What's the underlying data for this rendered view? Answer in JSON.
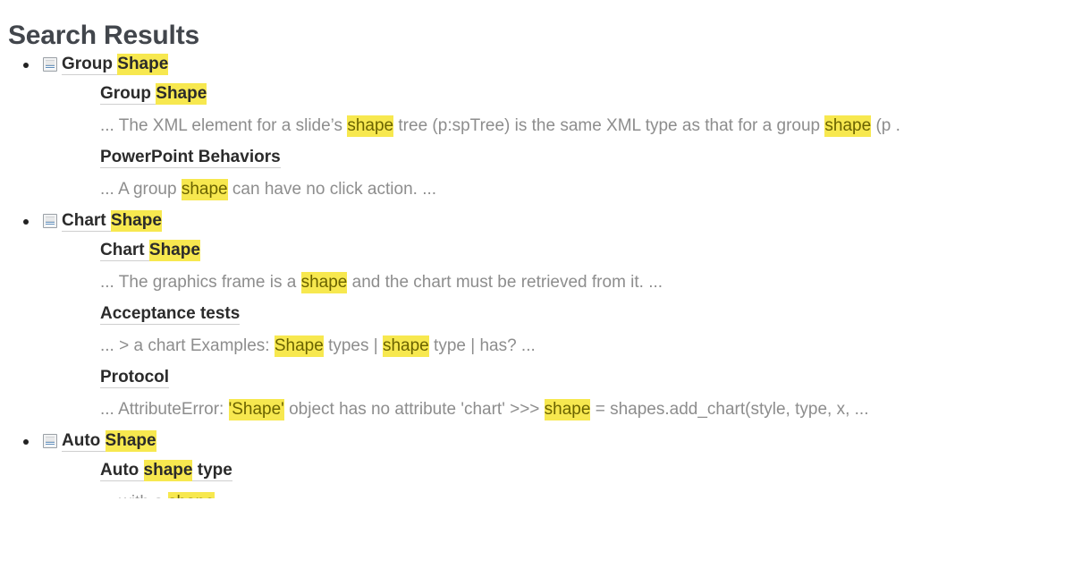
{
  "page": {
    "title": "Search Results",
    "highlight_color": "#f7e84f",
    "title_color": "#42464c",
    "snippet_color": "#8d8d8d",
    "link_color": "#2b2b2b"
  },
  "results": [
    {
      "icon": "document-icon",
      "link_parts": [
        {
          "text": "Group ",
          "highlight": false
        },
        {
          "text": "Shape",
          "highlight": true
        }
      ],
      "sub_results": [
        {
          "title_parts": [
            {
              "text": "Group ",
              "highlight": false
            },
            {
              "text": "Shape",
              "highlight": true
            }
          ],
          "snippet_parts": [
            {
              "text": "... The XML element for a slide’s ",
              "highlight": false
            },
            {
              "text": "shape",
              "highlight": true
            },
            {
              "text": " tree (p:spTree) is the same XML type as that for a group ",
              "highlight": false
            },
            {
              "text": "shape",
              "highlight": true
            },
            {
              "text": " (p .",
              "highlight": false
            }
          ]
        },
        {
          "title_parts": [
            {
              "text": "PowerPoint Behaviors",
              "highlight": false
            }
          ],
          "snippet_parts": [
            {
              "text": "... A group ",
              "highlight": false
            },
            {
              "text": "shape",
              "highlight": true
            },
            {
              "text": " can have no click action. ...",
              "highlight": false
            }
          ]
        }
      ]
    },
    {
      "icon": "document-icon",
      "link_parts": [
        {
          "text": "Chart ",
          "highlight": false
        },
        {
          "text": "Shape",
          "highlight": true
        }
      ],
      "sub_results": [
        {
          "title_parts": [
            {
              "text": "Chart ",
              "highlight": false
            },
            {
              "text": "Shape",
              "highlight": true
            }
          ],
          "snippet_parts": [
            {
              "text": "... The graphics frame is a ",
              "highlight": false
            },
            {
              "text": "shape",
              "highlight": true
            },
            {
              "text": " and the chart must be retrieved from it. ...",
              "highlight": false
            }
          ]
        },
        {
          "title_parts": [
            {
              "text": "Acceptance tests",
              "highlight": false
            }
          ],
          "snippet_parts": [
            {
              "text": "... > a chart Examples: ",
              "highlight": false
            },
            {
              "text": "Shape",
              "highlight": true
            },
            {
              "text": " types | ",
              "highlight": false
            },
            {
              "text": "shape",
              "highlight": true
            },
            {
              "text": " type | has? ...",
              "highlight": false
            }
          ]
        },
        {
          "title_parts": [
            {
              "text": "Protocol",
              "highlight": false
            }
          ],
          "snippet_parts": [
            {
              "text": "... AttributeError: ",
              "highlight": false
            },
            {
              "text": "'Shape'",
              "highlight": true
            },
            {
              "text": " object has no attribute 'chart' >>> ",
              "highlight": false
            },
            {
              "text": "shape",
              "highlight": true
            },
            {
              "text": " = shapes.add_chart(style, type, x, ...",
              "highlight": false
            }
          ]
        }
      ]
    },
    {
      "icon": "document-icon",
      "link_parts": [
        {
          "text": "Auto ",
          "highlight": false
        },
        {
          "text": "Shape",
          "highlight": true
        }
      ],
      "sub_results": [
        {
          "title_parts": [
            {
              "text": "Auto ",
              "highlight": false
            },
            {
              "text": "shape",
              "highlight": true
            },
            {
              "text": " type",
              "highlight": false
            }
          ],
          "snippet_parts": [
            {
              "text": "... with a ",
              "highlight": false
            },
            {
              "text": "shape",
              "highlight": true
            },
            {
              "text": " ...",
              "highlight": false
            }
          ]
        }
      ]
    }
  ]
}
